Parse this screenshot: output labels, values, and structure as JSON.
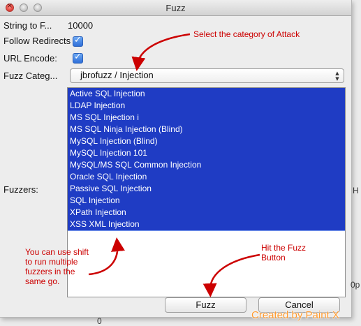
{
  "window": {
    "title": "Fuzz"
  },
  "form": {
    "string_label": "String to F...",
    "string_value": "10000",
    "follow_redirects_label": "Follow Redirects",
    "url_encode_label": "URL Encode:",
    "category_label": "Fuzz Categ...",
    "category_value": "jbrofuzz / Injection",
    "fuzzers_label": "Fuzzers:"
  },
  "fuzzers": [
    "Active SQL Injection",
    "LDAP Injection",
    "MS SQL Injection i",
    "MS SQL Ninja Injection (Blind)",
    "MySQL Injection (Blind)",
    "MySQL Injection 101",
    "MySQL/MS SQL Common Injection",
    "Oracle SQL Injection",
    "Passive SQL Injection",
    "SQL Injection",
    "XPath Injection",
    "XSS XML Injection"
  ],
  "buttons": {
    "fuzz": "Fuzz",
    "cancel": "Cancel"
  },
  "annotations": {
    "category_hint": "Select the category of Attack",
    "shift_hint": [
      "You can use shift",
      "to run multiple",
      "fuzzers in the",
      "same go."
    ],
    "fuzz_hint": [
      "Hit the Fuzz",
      "Button"
    ]
  },
  "watermark": "Created by Paint X",
  "background_fragments": {
    "right_top": "H",
    "right_bottom": "0p",
    "bottom": "0"
  },
  "colors": {
    "selection": "#1f3cc4",
    "annotation": "#cc0000",
    "watermark": "#ff9a2e"
  }
}
